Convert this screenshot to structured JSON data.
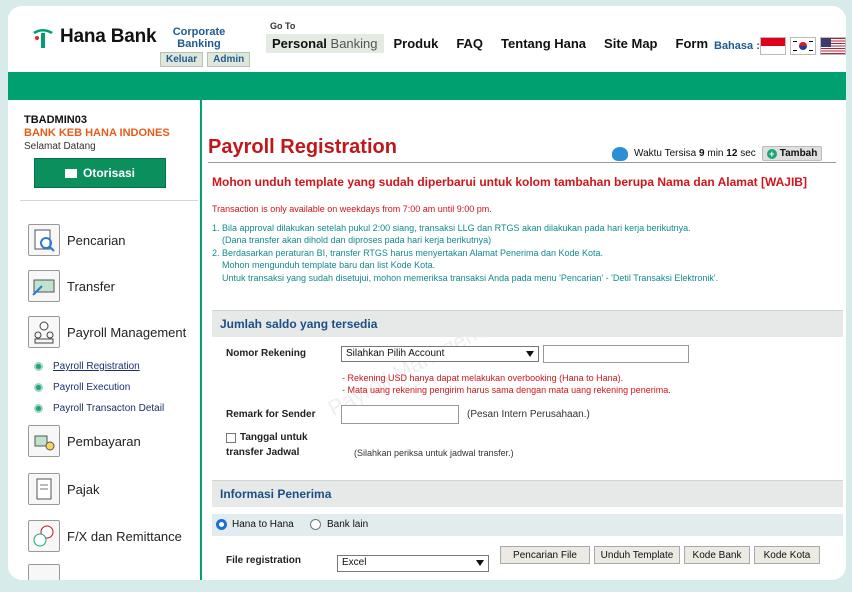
{
  "header": {
    "brand": "Hana Bank",
    "corporate_banking": "Corporate Banking",
    "keluar": "Keluar",
    "admin": "Admin",
    "goto": "Go To",
    "nav_personal_a": "Personal",
    "nav_personal_b": " Banking",
    "nav": [
      "Produk",
      "FAQ",
      "Tentang Hana",
      "Site Map",
      "Form"
    ],
    "bahasa": "Bahasa :",
    "flags": [
      "flag-indonesia",
      "flag-korea",
      "flag-usa"
    ]
  },
  "sidebar": {
    "user_id": "TBADMIN03",
    "bank_name": "BANK KEB HANA INDONES",
    "welcome": "Selamat Datang",
    "otorisasi": "Otorisasi",
    "menu": [
      "Pencarian",
      "Transfer",
      "Payroll Management",
      "Pembayaran",
      "Pajak",
      "F/X dan Remittance"
    ],
    "payroll_sub": [
      "Payroll Registration",
      "Payroll Execution",
      "Payroll Transacton Detail"
    ]
  },
  "main": {
    "title": "Payroll Registration",
    "timer_prefix": "Waktu Tersisa",
    "timer_min": "9",
    "timer_min_label": "min",
    "timer_sec": "12",
    "timer_sec_label": "sec",
    "tambah": "Tambah",
    "notice": "Mohon unduh template yang sudah diperbarui untuk kolom tambahan berupa Nama dan Alamat [WAJIB]",
    "availability": "Transaction is only available on weekdays from 7:00 am until 9:00 pm.",
    "info_lines": [
      "1. Bila approval dilakukan setelah pukul 2:00 siang, transaksi LLG dan RTGS akan dilakukan pada hari kerja berikutnya.",
      "   (Dana transfer akan dihold dan diproses pada hari kerja berikutnya)",
      "2. Berdasarkan peraturan BI, transfer RTGS harus menyertakan Alamat Penerima dan Kode Kota.",
      "   Mohon mengunduh template baru dan list Kode Kota.",
      "   Untuk transaksi yang sudah disetujui, mohon memeriksa transaksi Anda pada menu 'Pencarian' - 'Detil Transaksi Elektronik'."
    ],
    "section_saldo": "Jumlah saldo yang tersedia",
    "nomor_rekening_label": "Nomor Rekening",
    "nomor_rekening_value": "Silahkan Pilih Account",
    "rekening_notes": [
      "- Rekening USD hanya dapat melakukan overbooking (Hana to Hana).",
      "- Mata uang rekening pengirim harus sama dengan mata uang rekening penerima."
    ],
    "remark_label": "Remark for Sender",
    "remark_hint": "(Pesan Intern Perusahaan.)",
    "tanggal_label_1": "Tanggal untuk",
    "tanggal_label_2": "transfer Jadwal",
    "tanggal_hint": "(Silahkan periksa untuk jadwal transfer.)",
    "section_penerima": "Informasi Penerima",
    "radio_options": [
      "Hana to Hana",
      "Bank lain"
    ],
    "file_label": "File registration",
    "file_value": "Excel",
    "buttons": [
      "Pencarian File",
      "Unduh Template",
      "Kode Bank",
      "Kode Kota"
    ]
  }
}
